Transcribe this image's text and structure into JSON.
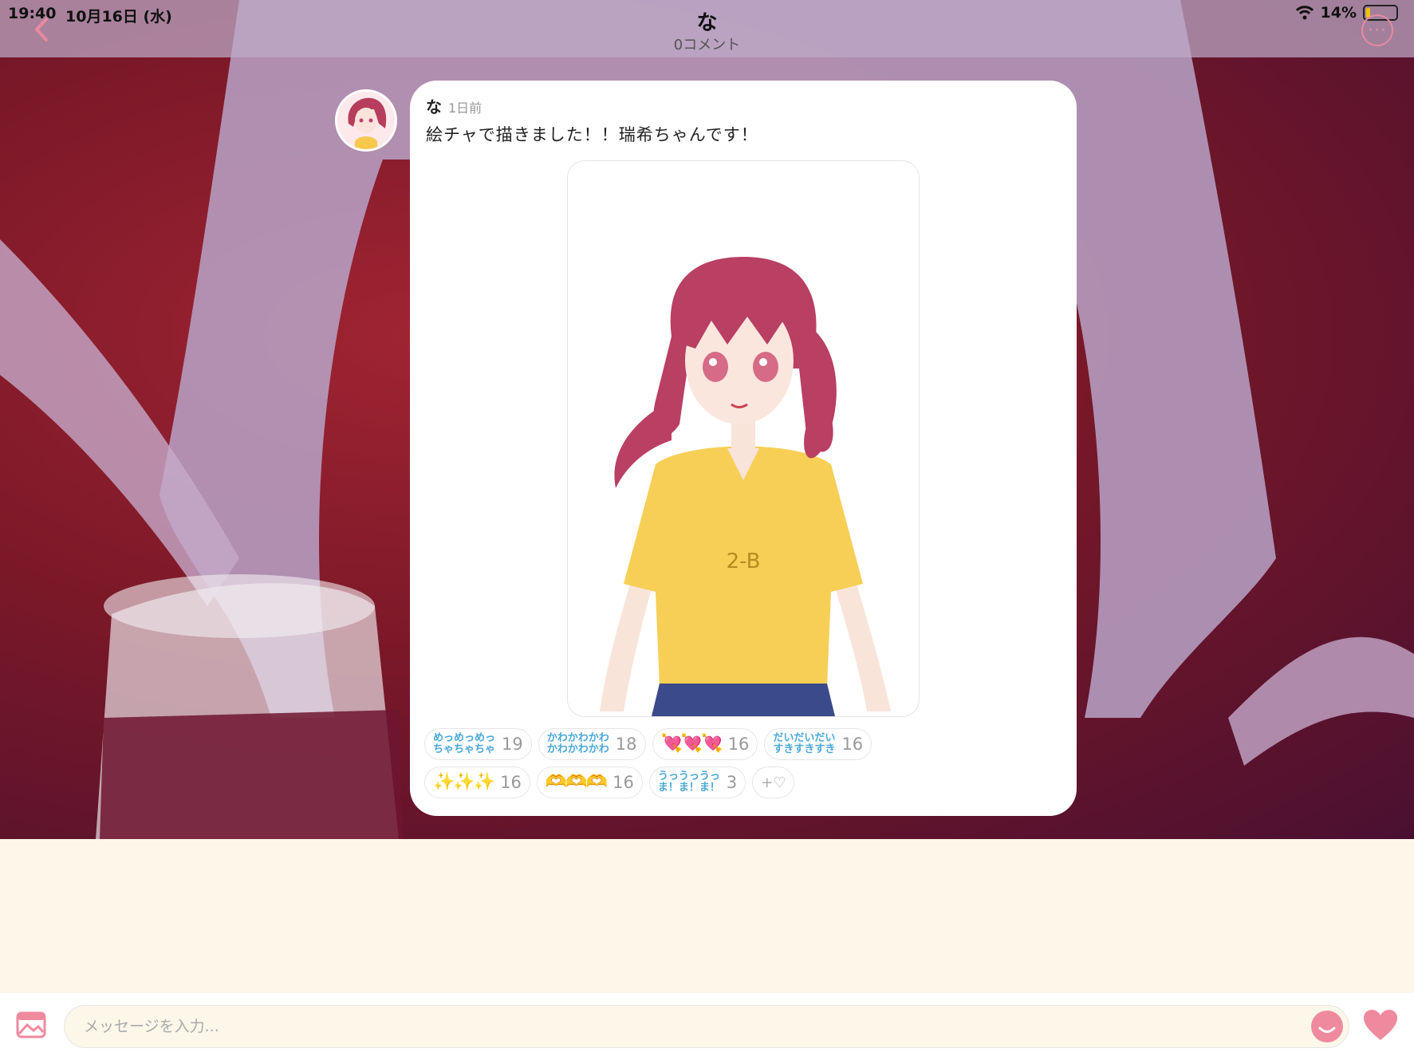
{
  "status_bar": {
    "time": "19:40",
    "date": "10月16日 (水)",
    "battery": "14%",
    "battery_level": 0.14
  },
  "header": {
    "title": "な",
    "subtitle": "0コメント"
  },
  "post": {
    "author": "な",
    "time": "1日前",
    "text": "絵チャで描きました！！瑞希ちゃんです！",
    "artwork_text": "2-B"
  },
  "reactions": {
    "row1": [
      {
        "label": "めっめっめっ\nちゃちゃちゃ",
        "count": "19"
      },
      {
        "label": "かわかわかわ\nかわかわかわ",
        "count": "18"
      },
      {
        "emoji": "💘💘💘",
        "count": "16"
      },
      {
        "label": "だいだいだい\nすきすきすき",
        "count": "16"
      }
    ],
    "row2": [
      {
        "emoji": "✨✨✨",
        "count": "16"
      },
      {
        "emoji": "🫶🫶🫶",
        "count": "16"
      },
      {
        "label": "うっうっうっ\nま！ま！ま！",
        "count": "3"
      }
    ],
    "add_label": "+♡"
  },
  "composer": {
    "placeholder": "メッセージを入力..."
  },
  "colors": {
    "accent_pink": "#ef8a9e",
    "reaction_text": "#4aa8d8",
    "header_overlay": "#beaac8",
    "composer_bg": "#fdf7ea"
  }
}
